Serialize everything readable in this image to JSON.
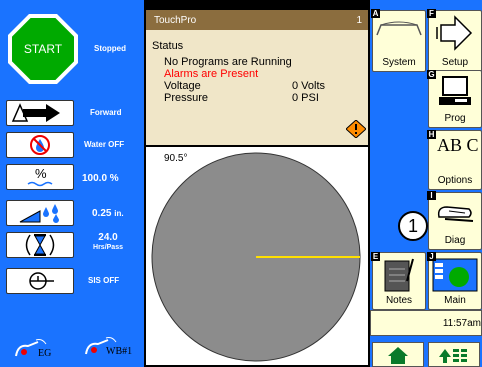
{
  "left": {
    "start_label": "START",
    "status": "Stopped",
    "direction": "Forward",
    "water": "Water OFF",
    "percent": "100.0 %",
    "depth_value": "0.25",
    "depth_unit": "in.",
    "hours_value": "24.0",
    "hours_unit": "Hrs/Pass",
    "sis": "SIS OFF",
    "endgun_label": "EG",
    "wb_label": "WB#1"
  },
  "center": {
    "app_title": "TouchPro",
    "panel_number": "1",
    "status_header": "Status",
    "no_programs": "No Programs are Running",
    "alarms": "Alarms are Present",
    "voltage_label": "Voltage",
    "voltage_value": "0 Volts",
    "pressure_label": "Pressure",
    "pressure_value": "0 PSI",
    "angle": "90.5°"
  },
  "right": {
    "buttons": [
      {
        "letter": "A",
        "label": "System"
      },
      {
        "letter": "F",
        "label": "Setup"
      },
      {
        "letter": "G",
        "label": "Prog"
      },
      {
        "letter": "H",
        "label": "Options"
      },
      {
        "letter": "I",
        "label": "Diag"
      },
      {
        "letter": "E",
        "label": "Notes"
      },
      {
        "letter": "J",
        "label": "Main"
      }
    ],
    "time": "11:57am",
    "options_glyph": "AB C",
    "callout": "1"
  },
  "colors": {
    "panel_blue": "#1a73ff",
    "title_brown": "#8b6d3e",
    "status_bg": "#f0e6c8",
    "alarm_red": "#ff0000",
    "start_green": "#00aa00",
    "pointer_yellow": "#ffe000",
    "field_gray": "#8c8c8c"
  },
  "icons": {
    "start": "start-octagon-icon",
    "direction": "forward-arrow-icon",
    "water": "water-off-icon",
    "percent": "percent-icon",
    "depth": "depth-drops-icon",
    "hours": "hourglass-icon",
    "sis": "sis-icon",
    "warning": "warning-diamond-icon"
  }
}
